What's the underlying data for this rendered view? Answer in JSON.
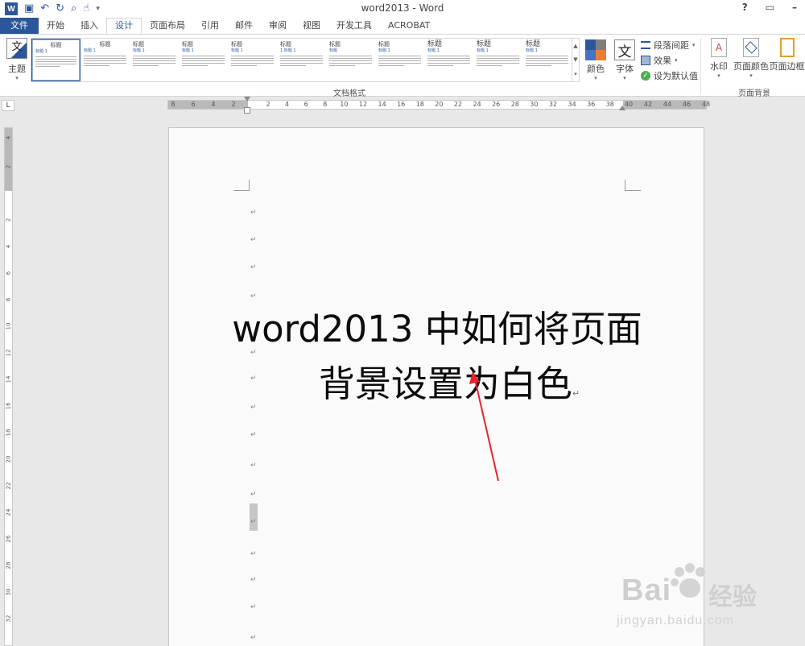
{
  "window": {
    "title": "word2013 - Word",
    "help": "?",
    "restore": "▭",
    "minimize": "–"
  },
  "qat": {
    "logo": "W",
    "save": "▣",
    "undo": "↶",
    "redo": "↻",
    "preview": "⌕",
    "touch": "☝",
    "more": "▾"
  },
  "tabs": [
    "文件",
    "开始",
    "插入",
    "设计",
    "页面布局",
    "引用",
    "邮件",
    "审阅",
    "视图",
    "开发工具",
    "ACROBAT"
  ],
  "active_tab": "设计",
  "ribbon": {
    "theme_label": "主题",
    "theme_icon_text": "文",
    "gallery_group_label": "文档格式",
    "gallery": [
      {
        "head": "标题",
        "sub": "标题 1"
      },
      {
        "head": "标题",
        "sub": "标题 1"
      },
      {
        "head": "标题",
        "sub": "标题 1"
      },
      {
        "head": "标题",
        "sub": "标题 1"
      },
      {
        "head": "标题",
        "sub": "标题 1"
      },
      {
        "head": "标题",
        "sub": "1 标题 1"
      },
      {
        "head": "标题",
        "sub": "标题"
      },
      {
        "head": "标题",
        "sub": "标题 1"
      },
      {
        "head": "标题",
        "sub": "标题 1"
      },
      {
        "head": "标题",
        "sub": "标题 1"
      },
      {
        "head": "标题",
        "sub": "标题 1"
      }
    ],
    "colors_label": "颜色",
    "fonts_label": "字体",
    "fonts_icon_text": "文",
    "paragraph_spacing": "段落间距",
    "effects": "效果",
    "set_default": "设为默认值",
    "watermark": "水印",
    "page_color": "页面颜色",
    "page_borders": "页面边框",
    "page_bg_group_label": "页面背景",
    "accent_colors": [
      "#2b579a",
      "#7f7f7f",
      "#ed7d31",
      "#4472c4"
    ]
  },
  "ruler": {
    "corner": "L",
    "h_left": [
      "8",
      "6",
      "4",
      "2"
    ],
    "h_main": [
      "2",
      "4",
      "6",
      "8",
      "10",
      "12",
      "14",
      "16",
      "18",
      "20",
      "22",
      "24",
      "26",
      "28",
      "30",
      "32",
      "34",
      "36",
      "38"
    ],
    "h_right": [
      "40",
      "42",
      "44",
      "46",
      "48"
    ],
    "v_top": [
      "4",
      "2"
    ],
    "v_main": [
      "2",
      "4",
      "6",
      "8",
      "10",
      "12",
      "14",
      "16",
      "18",
      "20",
      "22",
      "24",
      "26",
      "28",
      "30",
      "32"
    ]
  },
  "document": {
    "heading_line1": "word2013 中如何将页面",
    "heading_line2": "背景设置为白色",
    "paragraph_mark": "↵"
  },
  "watermark": {
    "brand": "Bai",
    "brand_cn": "经验",
    "url": "jingyan.baidu.com"
  }
}
